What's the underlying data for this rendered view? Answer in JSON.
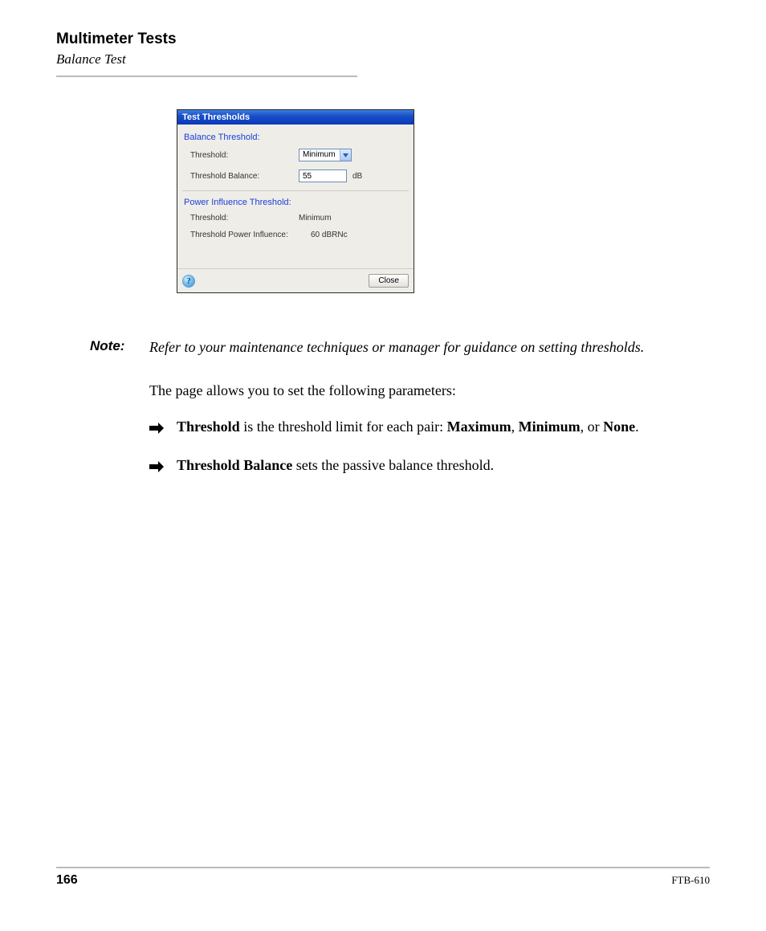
{
  "header": {
    "chapter": "Multimeter Tests",
    "section": "Balance Test"
  },
  "dialog": {
    "title": "Test Thresholds",
    "group1": {
      "label": "Balance Threshold:",
      "threshold_label": "Threshold:",
      "threshold_value": "Minimum",
      "balance_label": "Threshold Balance:",
      "balance_value": "55",
      "balance_unit": "dB"
    },
    "group2": {
      "label": "Power Influence Threshold:",
      "threshold_label": "Threshold:",
      "threshold_value": "Minimum",
      "pi_label": "Threshold Power Influence:",
      "pi_value": "60 dBRNc"
    },
    "help_symbol": "?",
    "close_label": "Close"
  },
  "note": {
    "label": "Note:",
    "text": "Refer to your maintenance techniques or manager for guidance on setting thresholds."
  },
  "body": {
    "intro": "The page allows you to set the following parameters:",
    "bullets": [
      {
        "lead": "Threshold",
        "mid": " is the threshold limit for each pair: ",
        "b1": "Maximum",
        "sep1": ", ",
        "b2": "Minimum",
        "sep2": ", or ",
        "b3": "None",
        "tail": "."
      },
      {
        "lead": "Threshold Balance",
        "mid": " sets the passive balance threshold.",
        "b1": "",
        "sep1": "",
        "b2": "",
        "sep2": "",
        "b3": "",
        "tail": ""
      }
    ]
  },
  "footer": {
    "page": "166",
    "model": "FTB-610"
  }
}
